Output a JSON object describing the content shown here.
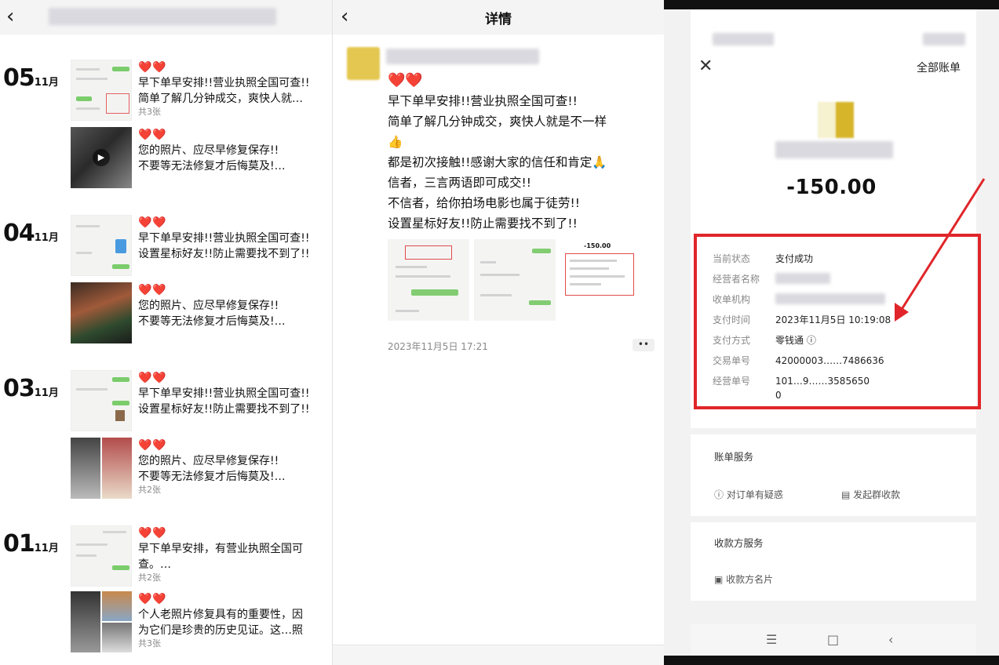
{
  "feed": {
    "back_icon": "chevron-left-icon",
    "days": [
      {
        "day": "05",
        "month": "11月",
        "posts": [
          {
            "hearts": "❤️❤️",
            "lines": [
              "早下单早安排!!营业执照全国可查!!",
              "简单了解几分钟成交，爽快人就…"
            ],
            "count": "共3张"
          },
          {
            "hearts": "❤️❤️",
            "lines": [
              "您的照片、应尽早修复保存!!",
              "不要等无法修复才后悔莫及!…"
            ],
            "count": ""
          }
        ]
      },
      {
        "day": "04",
        "month": "11月",
        "posts": [
          {
            "hearts": "❤️❤️",
            "lines": [
              "早下单早安排!!营业执照全国可查!!",
              "设置星标好友!!防止需要找不到了!!"
            ],
            "count": ""
          },
          {
            "hearts": "❤️❤️",
            "lines": [
              "您的照片、应尽早修复保存!!",
              "不要等无法修复才后悔莫及!…"
            ],
            "count": ""
          }
        ]
      },
      {
        "day": "03",
        "month": "11月",
        "posts": [
          {
            "hearts": "❤️❤️",
            "lines": [
              "早下单早安排!!营业执照全国可查!!",
              "设置星标好友!!防止需要找不到了!!"
            ],
            "count": ""
          },
          {
            "hearts": "❤️❤️",
            "lines": [
              "您的照片、应尽早修复保存!!",
              "不要等无法修复才后悔莫及!…"
            ],
            "count": "共2张"
          }
        ]
      },
      {
        "day": "01",
        "month": "11月",
        "posts": [
          {
            "hearts": "❤️❤️",
            "lines": [
              "早下单早安排，有营业执照全国可",
              "查。…"
            ],
            "count": "共2张"
          },
          {
            "hearts": "❤️❤️",
            "lines": [
              "个人老照片修复具有的重要性，因",
              "为它们是珍贵的历史见证。这…照"
            ],
            "count": "共3张"
          }
        ]
      }
    ]
  },
  "detail": {
    "title": "详情",
    "back_icon": "chevron-left-icon",
    "hearts": "❤️❤️",
    "lines": [
      "早下单早安排!!营业执照全国可查!!",
      "简单了解几分钟成交，爽快人就是不一样",
      "👍",
      "都是初次接触!!感谢大家的信任和肯定🙏",
      "信者，三言两语即可成交!!",
      "不信者，给你拍场电影也属于徒劳!!",
      "设置星标好友!!防止需要找不到了!!"
    ],
    "time": "2023年11月5日 17:21",
    "more_label": "••",
    "thumb3_amount": "-150.00"
  },
  "bill": {
    "close_icon": "close-icon",
    "all_bills": "全部账单",
    "amount": "-150.00",
    "rows": [
      {
        "key": "当前状态",
        "value": "支付成功"
      },
      {
        "key": "经营者名称",
        "value": ""
      },
      {
        "key": "收单机构",
        "value": ""
      },
      {
        "key": "支付时间",
        "value": "2023年11月5日 10:19:08"
      },
      {
        "key": "支付方式",
        "value": "零钱通 ⓘ"
      },
      {
        "key": "交易单号",
        "value": "42000003……7486636"
      },
      {
        "key": "经营单号",
        "value": "101…9……3585650"
      },
      {
        "key": "",
        "value": "0"
      }
    ],
    "section_bill_service": "账单服务",
    "link_question": "对订单有疑惑",
    "link_collect": "发起群收款",
    "section_payee": "收款方服务",
    "link_card": "收款方名片",
    "accent_red": "#e0262a"
  }
}
